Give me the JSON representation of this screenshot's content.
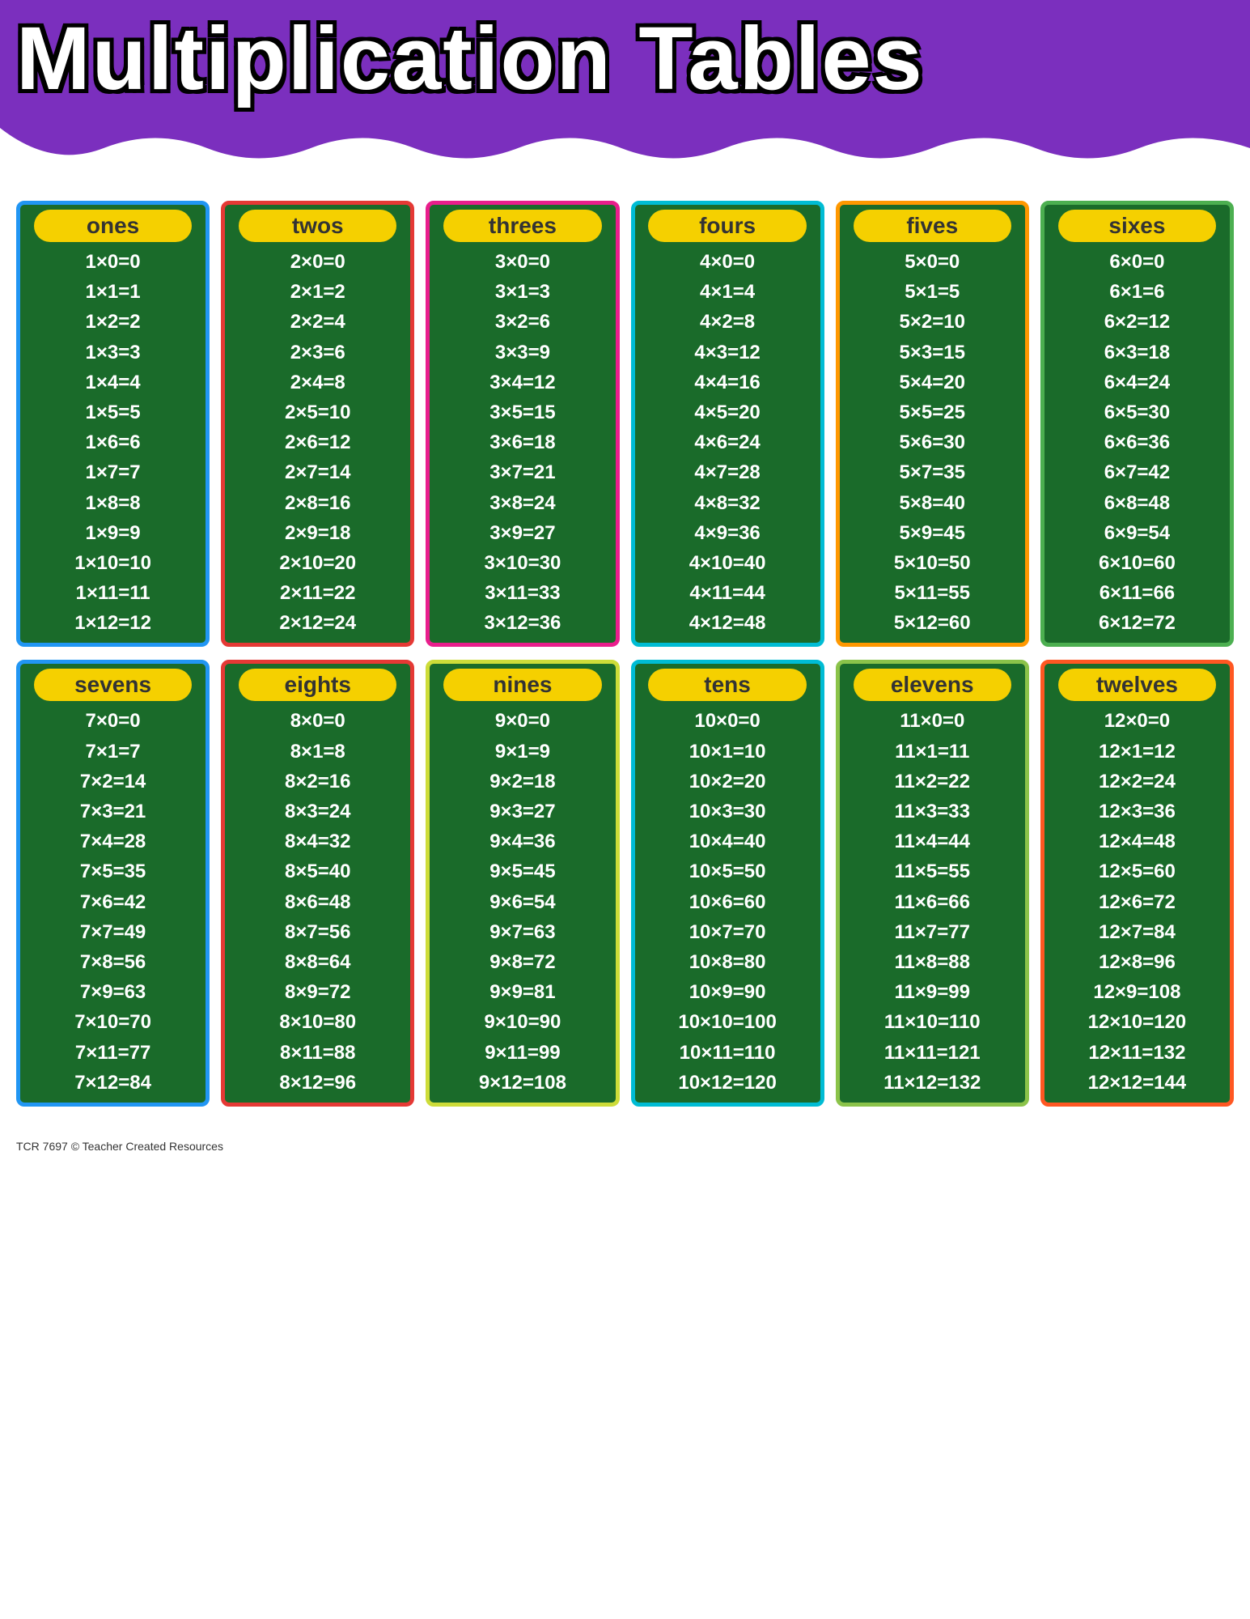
{
  "header": {
    "title": "Multiplication Tables",
    "bg_color": "#7b2fbe"
  },
  "footer": {
    "text": "TCR 7697 © Teacher Created Resources"
  },
  "tables": [
    {
      "label": "ones",
      "border": "blue-border",
      "equations": [
        "1×0=0",
        "1×1=1",
        "1×2=2",
        "1×3=3",
        "1×4=4",
        "1×5=5",
        "1×6=6",
        "1×7=7",
        "1×8=8",
        "1×9=9",
        "1×10=10",
        "1×11=11",
        "1×12=12"
      ]
    },
    {
      "label": "twos",
      "border": "red-border",
      "equations": [
        "2×0=0",
        "2×1=2",
        "2×2=4",
        "2×3=6",
        "2×4=8",
        "2×5=10",
        "2×6=12",
        "2×7=14",
        "2×8=16",
        "2×9=18",
        "2×10=20",
        "2×11=22",
        "2×12=24"
      ]
    },
    {
      "label": "threes",
      "border": "pink-border",
      "equations": [
        "3×0=0",
        "3×1=3",
        "3×2=6",
        "3×3=9",
        "3×4=12",
        "3×5=15",
        "3×6=18",
        "3×7=21",
        "3×8=24",
        "3×9=27",
        "3×10=30",
        "3×11=33",
        "3×12=36"
      ]
    },
    {
      "label": "fours",
      "border": "teal-border",
      "equations": [
        "4×0=0",
        "4×1=4",
        "4×2=8",
        "4×3=12",
        "4×4=16",
        "4×5=20",
        "4×6=24",
        "4×7=28",
        "4×8=32",
        "4×9=36",
        "4×10=40",
        "4×11=44",
        "4×12=48"
      ]
    },
    {
      "label": "fives",
      "border": "orange-border",
      "equations": [
        "5×0=0",
        "5×1=5",
        "5×2=10",
        "5×3=15",
        "5×4=20",
        "5×5=25",
        "5×6=30",
        "5×7=35",
        "5×8=40",
        "5×9=45",
        "5×10=50",
        "5×11=55",
        "5×12=60"
      ]
    },
    {
      "label": "sixes",
      "border": "green-border",
      "equations": [
        "6×0=0",
        "6×1=6",
        "6×2=12",
        "6×3=18",
        "6×4=24",
        "6×5=30",
        "6×6=36",
        "6×7=42",
        "6×8=48",
        "6×9=54",
        "6×10=60",
        "6×11=66",
        "6×12=72"
      ]
    },
    {
      "label": "sevens",
      "border": "blue-border",
      "equations": [
        "7×0=0",
        "7×1=7",
        "7×2=14",
        "7×3=21",
        "7×4=28",
        "7×5=35",
        "7×6=42",
        "7×7=49",
        "7×8=56",
        "7×9=63",
        "7×10=70",
        "7×11=77",
        "7×12=84"
      ]
    },
    {
      "label": "eights",
      "border": "red-border",
      "equations": [
        "8×0=0",
        "8×1=8",
        "8×2=16",
        "8×3=24",
        "8×4=32",
        "8×5=40",
        "8×6=48",
        "8×7=56",
        "8×8=64",
        "8×9=72",
        "8×10=80",
        "8×11=88",
        "8×12=96"
      ]
    },
    {
      "label": "nines",
      "border": "yellow-border",
      "equations": [
        "9×0=0",
        "9×1=9",
        "9×2=18",
        "9×3=27",
        "9×4=36",
        "9×5=45",
        "9×6=54",
        "9×7=63",
        "9×8=72",
        "9×9=81",
        "9×10=90",
        "9×11=99",
        "9×12=108"
      ]
    },
    {
      "label": "tens",
      "border": "teal-border",
      "equations": [
        "10×0=0",
        "10×1=10",
        "10×2=20",
        "10×3=30",
        "10×4=40",
        "10×5=50",
        "10×6=60",
        "10×7=70",
        "10×8=80",
        "10×9=90",
        "10×10=100",
        "10×11=110",
        "10×12=120"
      ]
    },
    {
      "label": "elevens",
      "border": "lime-border",
      "equations": [
        "11×0=0",
        "11×1=11",
        "11×2=22",
        "11×3=33",
        "11×4=44",
        "11×5=55",
        "11×6=66",
        "11×7=77",
        "11×8=88",
        "11×9=99",
        "11×10=110",
        "11×11=121",
        "11×12=132"
      ]
    },
    {
      "label": "twelves",
      "border": "deeporange-border",
      "equations": [
        "12×0=0",
        "12×1=12",
        "12×2=24",
        "12×3=36",
        "12×4=48",
        "12×5=60",
        "12×6=72",
        "12×7=84",
        "12×8=96",
        "12×9=108",
        "12×10=120",
        "12×11=132",
        "12×12=144"
      ]
    }
  ]
}
